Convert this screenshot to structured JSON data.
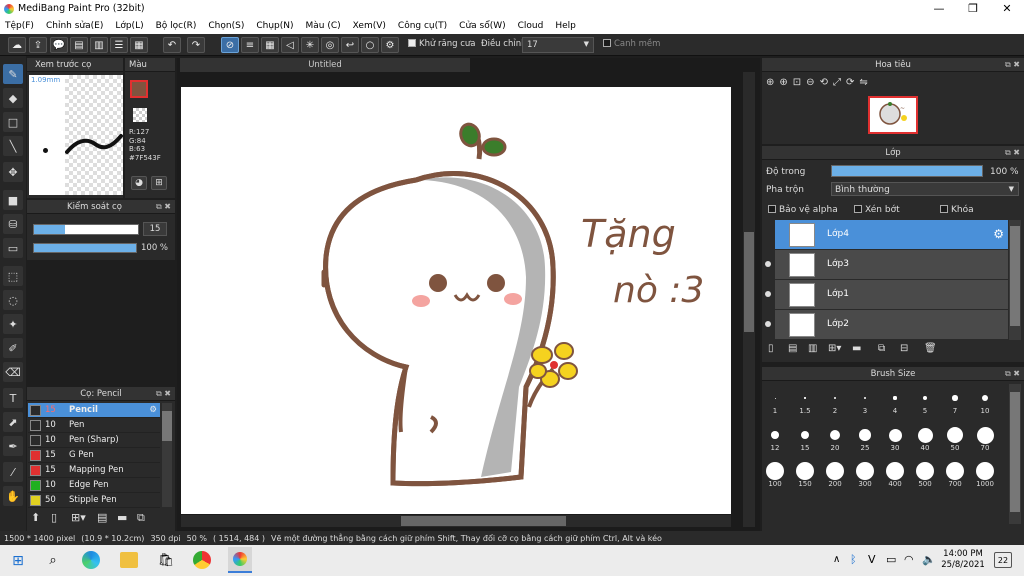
{
  "window": {
    "title": "MediBang Paint Pro (32bit)",
    "minimize": "—",
    "maximize": "❐",
    "close": "✕"
  },
  "menu": [
    "Tệp(F)",
    "Chỉnh sửa(E)",
    "Lớp(L)",
    "Bộ lọc(R)",
    "Chọn(S)",
    "Chụp(N)",
    "Màu (C)",
    "Xem(V)",
    "Công cụ(T)",
    "Cửa sổ(W)",
    "Cloud",
    "Help"
  ],
  "toolbar": {
    "antialias_label": "Khử răng cưa",
    "adjust_label": "Điều chỉnh",
    "adjust_value": "17",
    "edge_label": "Canh mềm"
  },
  "preview_panel": {
    "title": "Xem trước cọ",
    "size": "1.09mm"
  },
  "color_panel": {
    "title": "Màu",
    "r": "R:127",
    "g": "G:84",
    "b": "B:63",
    "hex": "#7F543F",
    "fg": "#7f543f"
  },
  "brush_control": {
    "title": "Kiểm soát cọ",
    "size": "15",
    "opacity": "100 %",
    "size_fraction": 0.3,
    "opacity_fraction": 1.0
  },
  "brush_list": {
    "title": "Cọ: Pencil",
    "items": [
      {
        "size": "15",
        "name": "Pencil",
        "color": "#2a2a2a",
        "selected": true
      },
      {
        "size": "10",
        "name": "Pen",
        "color": "#2a2a2a"
      },
      {
        "size": "10",
        "name": "Pen (Sharp)",
        "color": "#2a2a2a"
      },
      {
        "size": "15",
        "name": "G Pen",
        "color": "#e03030"
      },
      {
        "size": "15",
        "name": "Mapping Pen",
        "color": "#e03030"
      },
      {
        "size": "10",
        "name": "Edge Pen",
        "color": "#20b020"
      },
      {
        "size": "50",
        "name": "Stipple Pen",
        "color": "#e0d020"
      }
    ]
  },
  "canvas": {
    "tab_title": "Untitled",
    "text_line1": "Tặng",
    "text_line2": "nò :3"
  },
  "navigator": {
    "title": "Hoa tiêu"
  },
  "layer_panel": {
    "title": "Lớp",
    "opacity_label": "Độ trong",
    "opacity_value": "100 %",
    "opacity_fraction": 1.0,
    "blend_label": "Pha trộn",
    "blend_value": "Bình thường",
    "protect_alpha": "Bảo vệ alpha",
    "clipping": "Xén bớt",
    "lock": "Khóa",
    "layers": [
      {
        "name": "Lớp4",
        "selected": true
      },
      {
        "name": "Lớp3"
      },
      {
        "name": "Lớp1"
      },
      {
        "name": "Lớp2"
      }
    ]
  },
  "brush_size": {
    "title": "Brush Size",
    "sizes": [
      "1",
      "1.5",
      "2",
      "3",
      "4",
      "5",
      "7",
      "10",
      "12",
      "15",
      "20",
      "25",
      "30",
      "40",
      "50",
      "70",
      "100",
      "150",
      "200",
      "300",
      "400",
      "500",
      "700",
      "1000"
    ]
  },
  "status": {
    "dims": "1500 * 1400 pixel",
    "cm": "(10.9 * 10.2cm)",
    "dpi": "350 dpi",
    "zoom": "50 %",
    "coords": "( 1514, 484 )",
    "hint": "Vẽ một đường thẳng bằng cách giữ phím Shift, Thay đổi cỡ cọ bằng cách giữ phím Ctrl, Alt và kéo"
  },
  "taskbar": {
    "time": "14:00 PM",
    "date": "25/8/2021",
    "notif": "22"
  }
}
